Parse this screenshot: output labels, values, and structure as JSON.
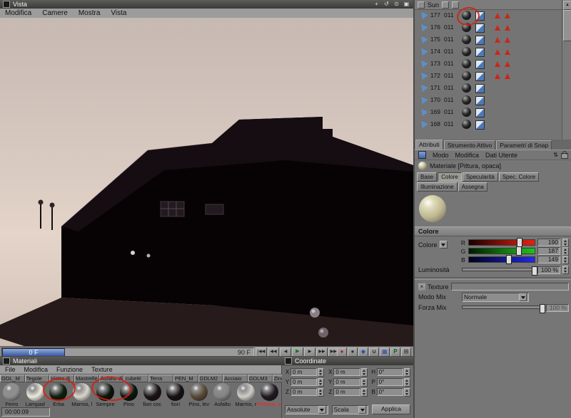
{
  "colors": {
    "annotation": "#d61f10",
    "selection_text": "#e03131",
    "current_frame_box": "#39599f"
  },
  "viewport": {
    "title": "Vista",
    "menu": [
      "Modifica",
      "Camere",
      "Mostra",
      "Vista"
    ],
    "title_icons": [
      {
        "name": "pan-icon",
        "glyph": "+"
      },
      {
        "name": "orbit-icon",
        "glyph": "↺"
      },
      {
        "name": "zoom-icon",
        "glyph": "⊙"
      },
      {
        "name": "maximize-icon",
        "glyph": "▣"
      }
    ]
  },
  "transport": {
    "current": "0 F",
    "end": "90 F",
    "buttons": [
      "|◀◀",
      "◀◀",
      "◀",
      "▶",
      "▶",
      "▶▶",
      "▶▶|"
    ],
    "utils": [
      {
        "name": "record-icon",
        "glyph": "●"
      },
      {
        "name": "sound-icon",
        "glyph": "●"
      },
      {
        "name": "keyframe-icon",
        "glyph": "◆"
      },
      {
        "name": "magnet-icon",
        "glyph": "∪"
      },
      {
        "name": "grid-icon",
        "glyph": "▦"
      },
      {
        "name": "coordinates-icon",
        "glyph": "P"
      },
      {
        "name": "snap-icon",
        "glyph": "⊞"
      }
    ]
  },
  "objects_panel": {
    "header": "Sun",
    "rows": [
      {
        "n": "177",
        "t": "011"
      },
      {
        "n": "176",
        "t": "011"
      },
      {
        "n": "175",
        "t": "011"
      },
      {
        "n": "174",
        "t": "011"
      },
      {
        "n": "173",
        "t": "011"
      },
      {
        "n": "172",
        "t": "011"
      },
      {
        "n": "171",
        "t": "011"
      },
      {
        "n": "170",
        "t": "011"
      },
      {
        "n": "169",
        "t": "011"
      },
      {
        "n": "168",
        "t": "011"
      }
    ]
  },
  "attributes": {
    "tabs": [
      "Attributi",
      "Strumento Attivo",
      "Parametri di Snap"
    ],
    "menu": [
      "Modo",
      "Modifica",
      "Dati Utente"
    ],
    "object_title": "Materiale [Pittura, opaca]",
    "section_tabs": [
      "Base",
      "Colore",
      "Specularità",
      "Spec. Colore",
      "Illuminazione",
      "Assegna"
    ],
    "section_header": "Colore",
    "color_label": "Colore",
    "channels": [
      {
        "c": "R",
        "v": "190"
      },
      {
        "c": "G",
        "v": "187"
      },
      {
        "c": "B",
        "v": "149"
      }
    ],
    "brightness": {
      "label": "Luminosità",
      "value": "100 %"
    },
    "texture": {
      "label": "Texture"
    },
    "mix_mode": {
      "label": "Modo Mix",
      "value": "Normale"
    },
    "mix_strength": {
      "label": "Forza Mix",
      "value": "100 %"
    },
    "material_color": "#bdb792"
  },
  "materials_panel": {
    "title": "Materiali",
    "menu": [
      "File",
      "Modifica",
      "Funzione",
      "Texture"
    ],
    "top_labels": [
      "GDL_M",
      "Tegole",
      "pietre di",
      "Mastrelle",
      "Asfalto di",
      "cubetti",
      "Terra",
      "PEN_M",
      "GDLM2",
      "Acciaio",
      "GDLM3",
      "Zinco"
    ],
    "materials": [
      {
        "name": "Ferro",
        "color": "#8e8e8e"
      },
      {
        "name": "Lampad",
        "color": "#ece9dd"
      },
      {
        "name": "Erba",
        "color": "#0e1f0c"
      },
      {
        "name": "Marmo, l",
        "color": "#d8d5cc"
      },
      {
        "name": "Sempre",
        "color": "#0b140b"
      },
      {
        "name": "Pino",
        "color": "#0c150e"
      },
      {
        "name": "fiori coc",
        "color": "#1a1214"
      },
      {
        "name": "fiori",
        "color": "#161012"
      },
      {
        "name": "Pino, lev",
        "color": "#5a4a38"
      },
      {
        "name": "Asfalto",
        "color": "#848484"
      },
      {
        "name": "Marmo, r",
        "color": "#cfcdc6"
      },
      {
        "name": "Pittura, o",
        "color": "#201a20"
      }
    ],
    "status": "00:00:09"
  },
  "coordinate_panel": {
    "title": "Coordinate",
    "fields": [
      {
        "l": "X",
        "v": "0 m"
      },
      {
        "l": "X",
        "v": "0 m"
      },
      {
        "l": "H",
        "v": "0°"
      },
      {
        "l": "Y",
        "v": "0 m"
      },
      {
        "l": "Y",
        "v": "0 m"
      },
      {
        "l": "P",
        "v": "0°"
      },
      {
        "l": "Z",
        "v": "0 m"
      },
      {
        "l": "Z",
        "v": "0 m"
      },
      {
        "l": "B",
        "v": "0°"
      }
    ],
    "mode_select": "Assolute",
    "scale_select": "Scala",
    "apply_label": "Applica"
  }
}
